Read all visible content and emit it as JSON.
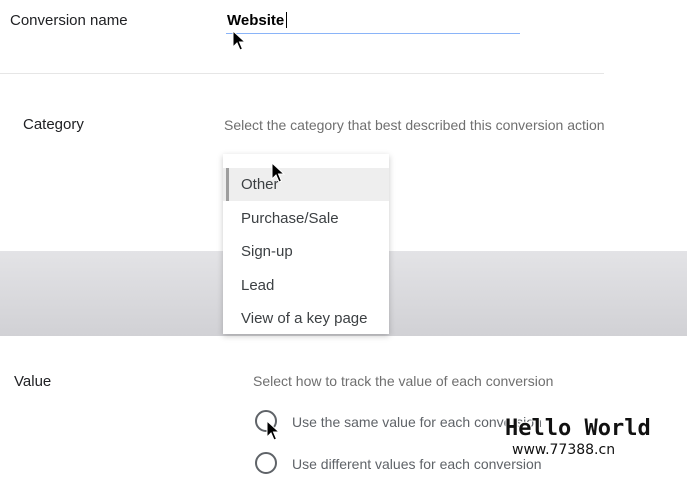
{
  "conversion_name": {
    "label": "Conversion name",
    "value": "Website"
  },
  "category": {
    "label": "Category",
    "helper": "Select the category that best described this conversion action",
    "options": [
      {
        "label": "Other",
        "selected": true
      },
      {
        "label": "Purchase/Sale",
        "selected": false
      },
      {
        "label": "Sign-up",
        "selected": false
      },
      {
        "label": "Lead",
        "selected": false
      },
      {
        "label": "View of a key page",
        "selected": false
      }
    ]
  },
  "value": {
    "label": "Value",
    "helper": "Select how to track the value of each conversion",
    "options": [
      {
        "label": "Use the same value for each conversion"
      },
      {
        "label": "Use different values for each conversion"
      }
    ]
  },
  "watermark": {
    "title": "Hello World",
    "url": "www.77388.cn"
  },
  "colors": {
    "input_underline": "#8ab4f8",
    "band": "#d6d6da",
    "menu_selected": "#eeeeee"
  }
}
